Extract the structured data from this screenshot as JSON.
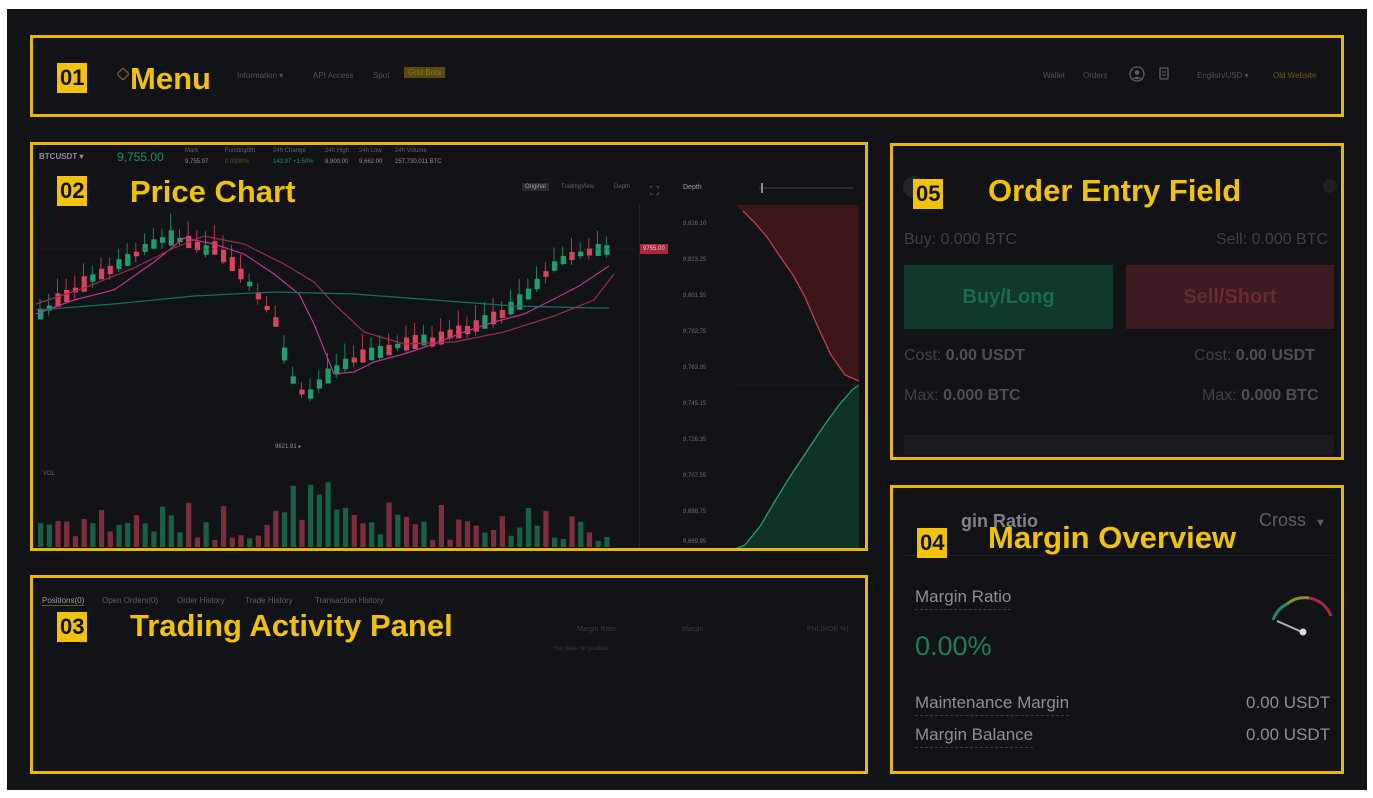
{
  "menu": {
    "number": "01",
    "title": "Menu",
    "nav_items": [
      "Information ▾",
      "API Access",
      "Spot"
    ],
    "highlight_item": "Grid Bots",
    "right_items": [
      "Wallet",
      "Orders"
    ],
    "language": "English/USD ▾",
    "old_website": "Old Website"
  },
  "price_chart": {
    "number": "02",
    "title": "Price Chart",
    "symbol": "BTCUSDT ▾",
    "last_price": "9,755.00",
    "stats_labels": [
      "Mark",
      "Funding/8h",
      "24h Change",
      "24h High",
      "24h Low",
      "24h Volume"
    ],
    "stats_values": [
      "9,755.97",
      "0.0100%",
      "143.97 +1.50%",
      "9,900.00",
      "9,662.00",
      "257,730,011 BTC"
    ],
    "view_options": [
      "Original",
      "TradingView",
      "Depth"
    ],
    "depth_label": "Depth",
    "price_tag": "9755.00",
    "low_tag": "9621.91 ▸",
    "vol_label": "VOL",
    "depth_prices": [
      "9,826.10",
      "9,823.25",
      "9,801.55",
      "9,782.75",
      "9,763.95",
      "9,745.15",
      "9,726.35",
      "9,707.55",
      "9,688.75",
      "9,669.95"
    ]
  },
  "activity": {
    "number": "03",
    "title": "Trading Activity Panel",
    "tabs": [
      "Positions(0)",
      "Open Orders(0)",
      "Order History",
      "Trade History",
      "Transaction History"
    ],
    "columns": [
      "Margin Ratio",
      "Margin",
      "PNL(ROE %)"
    ],
    "empty_text": "You have no position."
  },
  "order_entry": {
    "number": "05",
    "title": "Order Entry Field",
    "buy_amount": "Buy: 0.000 BTC",
    "sell_amount": "Sell: 0.000 BTC",
    "buy_button": "Buy/Long",
    "sell_button": "Sell/Short",
    "cost_left_label": "Cost:",
    "cost_left_value": "0.00 USDT",
    "cost_right_label": "Cost:",
    "cost_right_value": "0.00 USDT",
    "max_left_label": "Max:",
    "max_left_value": "0.000 BTC",
    "max_right_label": "Max:",
    "max_right_value": "0.000 BTC"
  },
  "margin_overview": {
    "number": "04",
    "title": "Margin Overview",
    "header_fragment": "gin Ratio",
    "mode": "Cross",
    "ratio_label": "Margin Ratio",
    "ratio_value": "0.00%",
    "maintenance_label": "Maintenance Margin",
    "maintenance_value": "0.00 USDT",
    "balance_label": "Margin Balance",
    "balance_value": "0.00 USDT"
  },
  "colors": {
    "accent": "#f0c20b",
    "background": "#121316",
    "up": "#1f9e6e",
    "down": "#d6455d"
  }
}
